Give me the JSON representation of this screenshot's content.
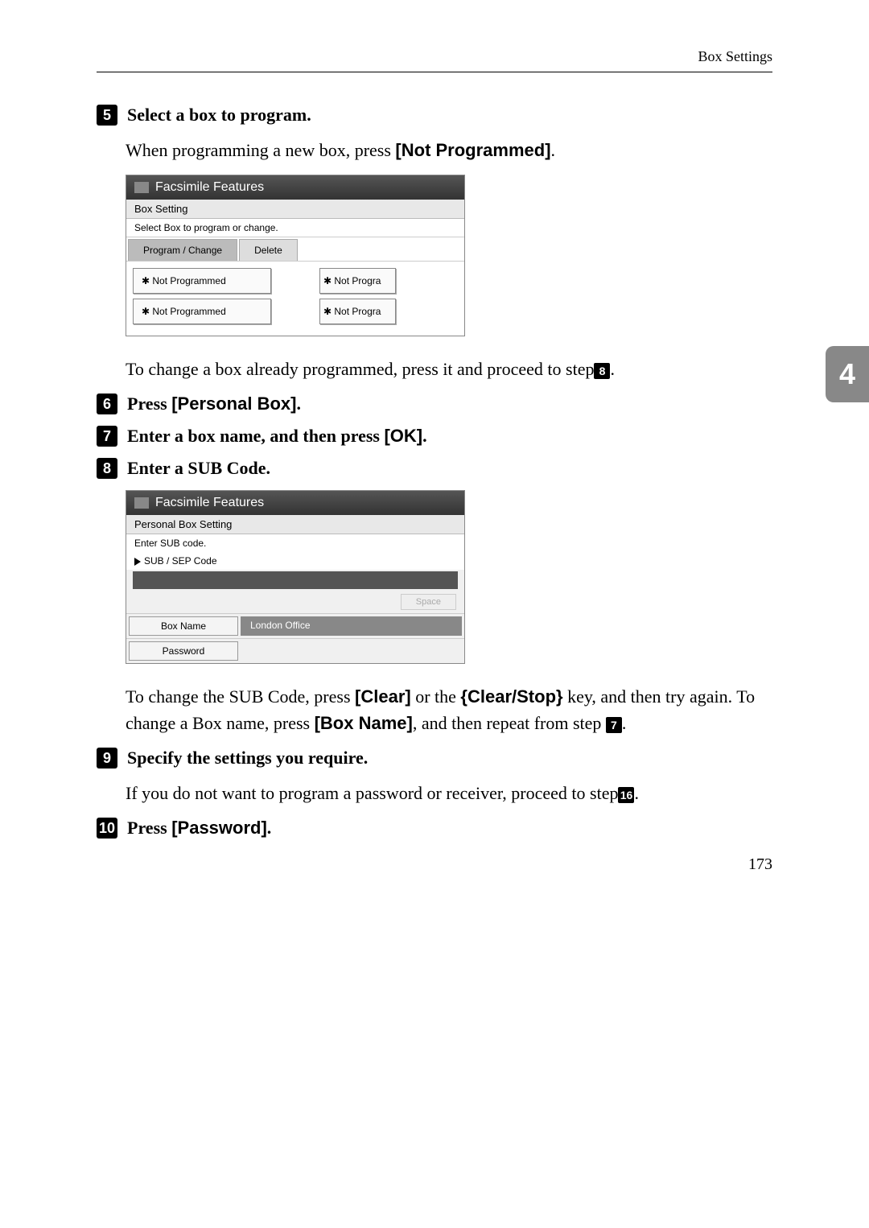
{
  "header": {
    "section_title": "Box Settings"
  },
  "side_tab": "4",
  "steps": {
    "s5": {
      "num": "5",
      "title": "Select a box to program.",
      "body_pre": "When programming a new box, press ",
      "body_btn": "[Not Programmed]",
      "body_post": ".",
      "after_ss_pre": "To change a box already programmed, press it and proceed to step",
      "after_ss_ref": "8",
      "after_ss_post": "."
    },
    "s6": {
      "num": "6",
      "pre": "Press ",
      "btn": "[Personal Box]",
      "post": "."
    },
    "s7": {
      "num": "7",
      "pre": "Enter a box name, and then press ",
      "btn": "[OK]",
      "post": "."
    },
    "s8": {
      "num": "8",
      "title": "Enter a SUB Code.",
      "after_pre": "To change the SUB Code, press ",
      "after_b1": "[Clear]",
      "after_mid1": " or the ",
      "after_key": "{Clear/Stop}",
      "after_mid2": " key, and then try again. To change a Box name, press ",
      "after_b2": "[Box Name]",
      "after_mid3": ", and then repeat from step ",
      "after_ref": "7",
      "after_post": "."
    },
    "s9": {
      "num": "9",
      "title": "Specify the settings you require.",
      "body_pre": "If you do not want to program a password or receiver, proceed to step",
      "body_ref": "16",
      "body_post": "."
    },
    "s10": {
      "num": "10",
      "pre": "Press ",
      "btn": "[Password]",
      "post": "."
    }
  },
  "ss1": {
    "title": "Facsimile Features",
    "sub": "Box Setting",
    "hint": "Select Box to program or change.",
    "tab1": "Program / Change",
    "tab2": "Delete",
    "btn_np": "✱ Not Programmed",
    "btn_np_r": "✱ Not Progra"
  },
  "ss2": {
    "title": "Facsimile Features",
    "sub": "Personal Box Setting",
    "hint": "Enter SUB code.",
    "field": "SUB / SEP Code",
    "space": "Space",
    "row1_label": "Box Name",
    "row1_value": "London Office",
    "row2_label": "Password"
  },
  "page_number": "173"
}
